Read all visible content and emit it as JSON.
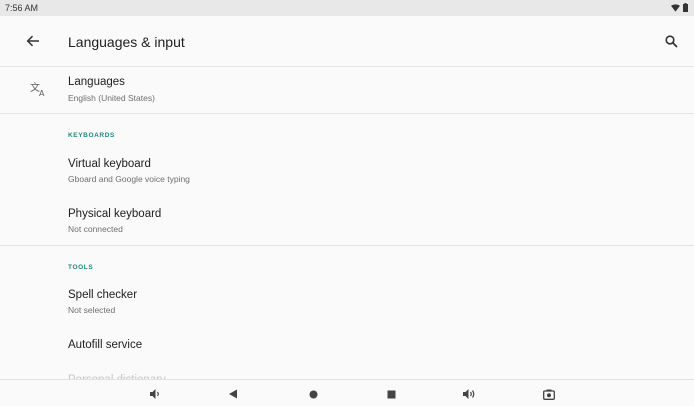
{
  "status_bar": {
    "time": "7:56 AM",
    "icons": [
      "wifi-icon",
      "battery-icon"
    ]
  },
  "app_bar": {
    "title": "Languages & input",
    "back_icon": "arrow-back-icon",
    "search_icon": "search-icon"
  },
  "languages": {
    "icon": "translate-icon",
    "title": "Languages",
    "subtitle": "English (United States)"
  },
  "keyboards_section": {
    "header": "KEYBOARDS",
    "items": [
      {
        "title": "Virtual keyboard",
        "subtitle": "Gboard and Google voice typing"
      },
      {
        "title": "Physical keyboard",
        "subtitle": "Not connected"
      }
    ]
  },
  "tools_section": {
    "header": "TOOLS",
    "items": [
      {
        "title": "Spell checker",
        "subtitle": "Not selected"
      },
      {
        "title": "Autofill service"
      },
      {
        "title": "Personal dictionary"
      }
    ]
  },
  "nav_bar": {
    "buttons": [
      "volume-down-icon",
      "back-triangle-icon",
      "home-circle-icon",
      "recents-square-icon",
      "volume-up-icon",
      "camera-icon"
    ]
  },
  "colors": {
    "accent": "#1a8a80",
    "background": "#fafafa",
    "status_bar": "#e8e8e8"
  }
}
